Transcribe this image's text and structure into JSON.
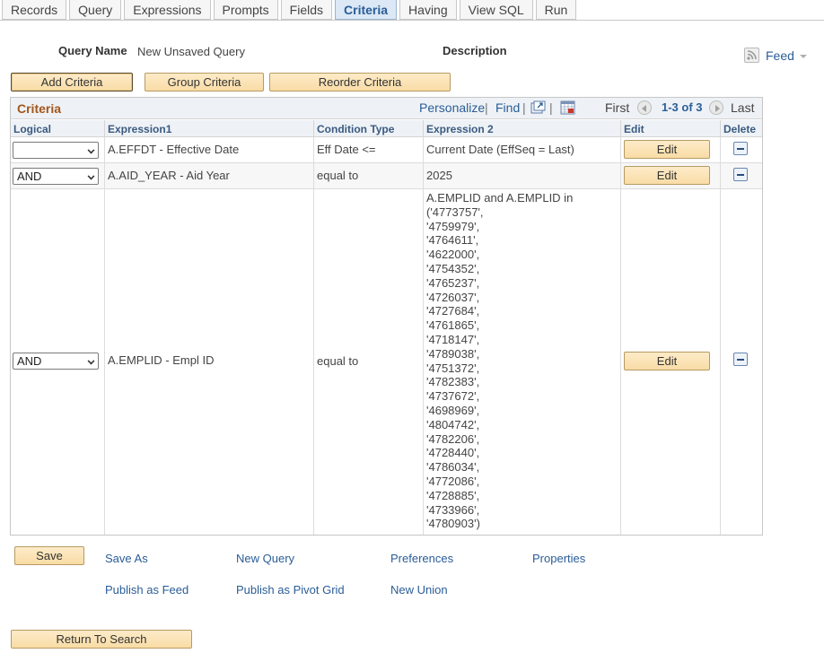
{
  "tabs": [
    "Records",
    "Query",
    "Expressions",
    "Prompts",
    "Fields",
    "Criteria",
    "Having",
    "View SQL",
    "Run"
  ],
  "active_tab": "Criteria",
  "query_name_label": "Query Name",
  "query_name_value": "New Unsaved Query",
  "description_label": "Description",
  "feed_label": "Feed",
  "buttons": {
    "add_criteria": "Add Criteria",
    "group_criteria": "Group Criteria",
    "reorder_criteria": "Reorder Criteria",
    "save": "Save",
    "return_to_search": "Return To Search"
  },
  "grid": {
    "title": "Criteria",
    "personalize": "Personalize",
    "find": "Find",
    "first": "First",
    "range": "1-3 of 3",
    "last": "Last",
    "columns": [
      "Logical",
      "Expression1",
      "Condition Type",
      "Expression 2",
      "Edit",
      "Delete"
    ],
    "edit_label": "Edit",
    "rows": [
      {
        "logical": "",
        "expression1": "A.EFFDT - Effective Date",
        "condition": "Eff Date <=",
        "expression2": "Current Date (EffSeq = Last)"
      },
      {
        "logical": "AND",
        "expression1": "A.AID_YEAR - Aid Year",
        "condition": "equal to",
        "expression2": "2025"
      },
      {
        "logical": "AND",
        "expression1": "A.EMPLID - Empl ID",
        "condition": "equal to",
        "expression2": "A.EMPLID and A.EMPLID in\n('4773757',\n'4759979',\n'4764611',\n'4622000',\n'4754352',\n'4765237',\n'4726037',\n'4727684',\n'4761865',\n'4718147',\n'4789038',\n'4751372',\n'4782383',\n'4737672',\n'4698969',\n'4804742',\n'4782206',\n'4728440',\n'4786034',\n'4772086',\n'4728885',\n'4733966',\n'4780903')"
      }
    ]
  },
  "links": {
    "save_as": "Save As",
    "new_query": "New Query",
    "preferences": "Preferences",
    "properties": "Properties",
    "publish_as_feed": "Publish as Feed",
    "publish_as_pivot_grid": "Publish as Pivot Grid",
    "new_union": "New Union"
  },
  "colors": {
    "link": "#2a5d97",
    "title": "#a3561b",
    "button": "#f9dca6"
  }
}
